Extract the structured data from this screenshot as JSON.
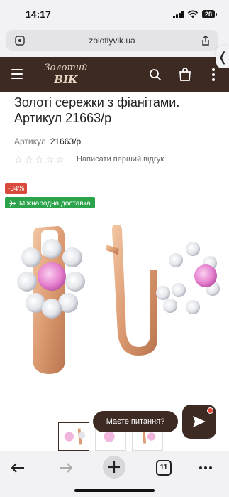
{
  "status_bar": {
    "time": "14:17",
    "battery": "28"
  },
  "browser": {
    "url": "zolotiyvik.ua",
    "tab_count": "11"
  },
  "site": {
    "logo_line1": "Золотий",
    "logo_line2": "ВІК",
    "brand_color": "#3d2a23"
  },
  "product": {
    "title": "Золоті сережки з фіанітами. Артикул 21663/р",
    "sku_label": "Артикул",
    "sku_value": "21663/р",
    "rating_stars": 0,
    "review_link": "Написати перший відгук",
    "discount_badge": "-34%",
    "shipping_badge": "Міжнародна доставка"
  },
  "chat": {
    "prompt": "Маєте питання?"
  },
  "icons": [
    "lock-icon",
    "share-icon",
    "menu-icon",
    "search-icon",
    "cart-icon",
    "more-vertical-icon",
    "plane-icon",
    "send-icon",
    "back-arrow-icon",
    "forward-arrow-icon",
    "plus-icon",
    "tabs-icon",
    "more-horizontal-icon"
  ]
}
